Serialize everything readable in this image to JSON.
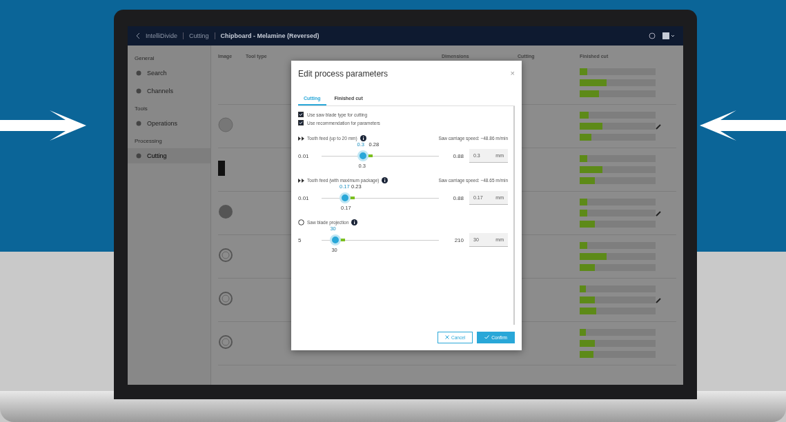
{
  "topbar": {
    "breadcrumb": [
      "IntelliDivide",
      "Cutting",
      "Chipboard - Melamine (Reversed)"
    ]
  },
  "sidebar": {
    "sections": [
      {
        "title": "General",
        "items": [
          {
            "label": "Search",
            "selected": false
          },
          {
            "label": "Channels",
            "selected": false
          }
        ]
      },
      {
        "title": "Tools",
        "items": [
          {
            "label": "Operations",
            "selected": false
          }
        ]
      },
      {
        "title": "Processing",
        "items": [
          {
            "label": "Cutting",
            "selected": true
          }
        ]
      }
    ]
  },
  "table": {
    "columns": [
      "Image",
      "Tool type",
      "Dimensions",
      "Cutting",
      "Finished cut"
    ],
    "rows": [
      {
        "kind": "blank",
        "meters": [
          {
            "level": 0.1
          },
          {
            "level": 0.35
          },
          {
            "level": 0.25
          }
        ]
      },
      {
        "kind": "round",
        "meters": [
          {
            "level": 0.12
          },
          {
            "level": 0.3
          },
          {
            "level": 0.15
          }
        ]
      },
      {
        "kind": "block",
        "meters": [
          {
            "level": 0.1
          },
          {
            "level": 0.3
          },
          {
            "level": 0.2
          }
        ]
      },
      {
        "kind": "dark",
        "meters": [
          {
            "level": 0.1
          },
          {
            "level": 0.1
          },
          {
            "level": 0.2
          }
        ]
      },
      {
        "kind": "ring",
        "meters": [
          {
            "level": 0.1
          },
          {
            "level": 0.35
          },
          {
            "level": 0.2
          }
        ]
      },
      {
        "kind": "ring",
        "meters": [
          {
            "level": 0.08
          },
          {
            "level": 0.2
          },
          {
            "level": 0.22
          }
        ]
      },
      {
        "kind": "ring",
        "meters": [
          {
            "level": 0.08
          },
          {
            "level": 0.2
          },
          {
            "level": 0.18
          }
        ]
      }
    ]
  },
  "dialog": {
    "title": "Edit process parameters",
    "close": "×",
    "tabs": [
      {
        "label": "Cutting",
        "selected": true
      },
      {
        "label": "Finished cut",
        "selected": false
      }
    ],
    "options": [
      {
        "label": "Use saw blade type for cutting",
        "checked": true
      },
      {
        "label": "Use recommendation for parameters",
        "checked": true
      }
    ],
    "params": [
      {
        "kind": "feed",
        "label": "Tooth feed (up to 20 mm)",
        "speed": "Saw carriage speed: ~48.86 m/min",
        "min": "0.01",
        "max": "0.88",
        "level": 0.35,
        "current": "0.3",
        "recommended": "0.28",
        "below": "0.3",
        "value": "0.3",
        "unit": "mm"
      },
      {
        "kind": "feed",
        "label": "Tooth feed (with maximum package)",
        "speed": "Saw carriage speed: ~48.65 m/min",
        "min": "0.01",
        "max": "0.88",
        "level": 0.2,
        "current": "0.17",
        "recommended": "0.23",
        "below": "0.17",
        "value": "0.17",
        "unit": "mm"
      },
      {
        "kind": "projection",
        "label": "Saw blade projection",
        "min": "5",
        "max": "210",
        "level": 0.12,
        "current": "30",
        "below": "30",
        "value": "30",
        "unit": "mm"
      }
    ],
    "buttons": [
      {
        "kind": "secondary",
        "label": "Cancel"
      },
      {
        "kind": "primary",
        "label": "Confirm"
      }
    ]
  }
}
